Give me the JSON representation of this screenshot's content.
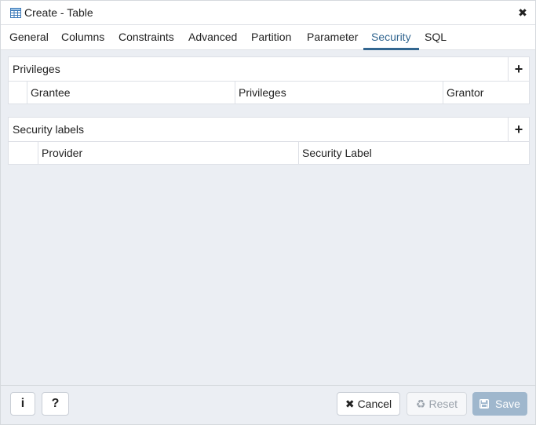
{
  "dialog": {
    "title": "Create - Table",
    "title_icon": "table-icon",
    "close_icon": "close-icon"
  },
  "tabs": [
    {
      "label": "General"
    },
    {
      "label": "Columns"
    },
    {
      "label": "Constraints"
    },
    {
      "label": "Advanced"
    },
    {
      "label": "Partition"
    },
    {
      "label": "Parameter"
    },
    {
      "label": "Security",
      "active": true
    },
    {
      "label": "SQL"
    }
  ],
  "privileges": {
    "title": "Privileges",
    "add_icon": "plus-icon",
    "columns": [
      "Grantee",
      "Privileges",
      "Grantor"
    ]
  },
  "security_labels": {
    "title": "Security labels",
    "add_icon": "plus-icon",
    "columns": [
      "Provider",
      "Security Label"
    ]
  },
  "footer": {
    "info_icon": "info-icon",
    "help_icon": "help-icon",
    "info_label": "i",
    "help_label": "?",
    "cancel_label": "Cancel",
    "reset_label": "Reset",
    "save_label": "Save"
  },
  "colors": {
    "accent": "#326690",
    "save_disabled": "#9fb7cd",
    "content_bg": "#ebeef3"
  }
}
